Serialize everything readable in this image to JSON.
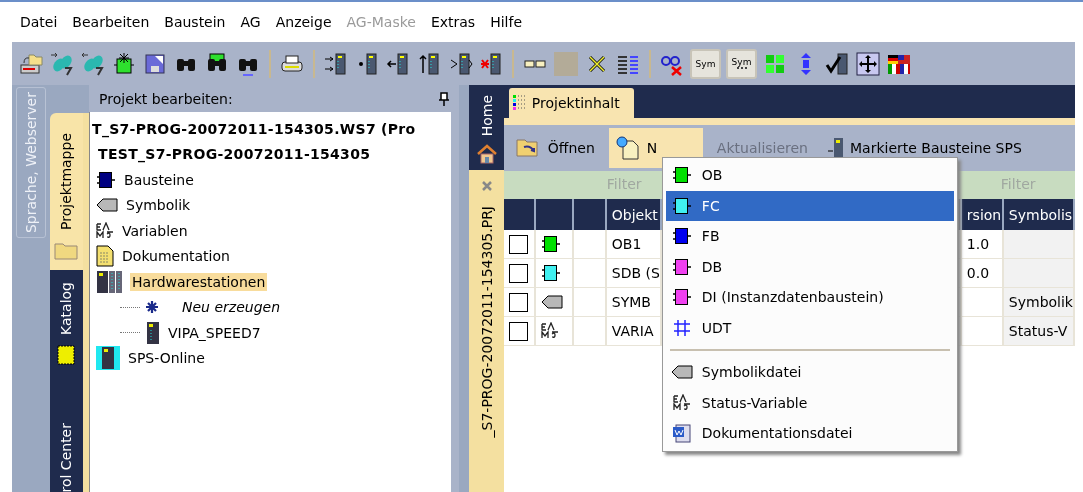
{
  "menu_bar": [
    {
      "label": "Datei",
      "disabled": false
    },
    {
      "label": "Bearbeiten",
      "disabled": false
    },
    {
      "label": "Baustein",
      "disabled": false
    },
    {
      "label": "AG",
      "disabled": false
    },
    {
      "label": "Anzeige",
      "disabled": false
    },
    {
      "label": "AG-Maske",
      "disabled": true
    },
    {
      "label": "Extras",
      "disabled": false
    },
    {
      "label": "Hilfe",
      "disabled": false
    }
  ],
  "toolbar": {
    "sym_buttons": [
      "Sym",
      "Sym"
    ]
  },
  "side_tabs": [
    {
      "label": "Sprache, Webserver",
      "disabled": true
    }
  ],
  "nav_tabs": [
    {
      "label": "Projektmappe",
      "selected": true
    },
    {
      "label": "Katalog",
      "selected": false
    },
    {
      "label": "rol Center",
      "selected": false
    }
  ],
  "tree_panel": {
    "title": "Projekt bearbeiten:",
    "tree": [
      {
        "label": "T_S7-PROG-20072011-154305.WS7 (Pro",
        "kind": "root",
        "selected": false,
        "children": [
          {
            "label": "TEST_S7-PROG-20072011-154305",
            "kind": "root",
            "selected": false,
            "children": [
              {
                "label": "Bausteine",
                "kind": "blocks",
                "selected": false
              },
              {
                "label": "Symbolik",
                "kind": "symbol",
                "selected": false
              },
              {
                "label": "Variablen",
                "kind": "variable",
                "selected": false
              },
              {
                "label": "Dokumentation",
                "kind": "document",
                "selected": false
              },
              {
                "label": "Hardwarestationen",
                "kind": "hardware",
                "selected": true,
                "children": [
                  {
                    "label": "Neu erzeugen",
                    "kind": "new",
                    "selected": false
                  },
                  {
                    "label": "VIPA_SPEED7",
                    "kind": "station",
                    "selected": false
                  }
                ]
              },
              {
                "label": "SPS-Online",
                "kind": "online",
                "selected": false
              }
            ]
          }
        ]
      }
    ]
  },
  "doc_tabs": [
    {
      "label": "Home",
      "kind": "home",
      "selected": false
    },
    {
      "label": "_S7-PROG-20072011-154305.PRJ",
      "kind": "project",
      "selected": true
    }
  ],
  "content": {
    "tabs": [
      {
        "label": "Projektinhalt",
        "selected": true
      }
    ],
    "actions": [
      {
        "label": "Öffnen",
        "kind": "open"
      },
      {
        "label": "N",
        "kind": "new"
      },
      {
        "label": "Aktualisieren",
        "kind": "plain"
      },
      {
        "label": "Markierte Bausteine SPS",
        "kind": "module"
      }
    ],
    "filters": [
      "Filter",
      "Filter"
    ],
    "columns": [
      "Objekt",
      "rsion",
      "Symbolis"
    ],
    "rows": [
      {
        "checked": false,
        "kind": "block",
        "color": "#00e000",
        "cells": [
          "OB1",
          "1.0",
          ""
        ]
      },
      {
        "checked": false,
        "kind": "block",
        "color": "#40f0f0",
        "cells": [
          "SDB (S",
          "0.0",
          ""
        ]
      },
      {
        "checked": false,
        "kind": "symbol",
        "cells": [
          "SYMB",
          "",
          "Symbolik"
        ]
      },
      {
        "checked": false,
        "kind": "variable",
        "cells": [
          "VARIA",
          "",
          "Status-V"
        ]
      }
    ]
  },
  "new_menu": [
    {
      "label": "OB",
      "kind": "block",
      "color": "#00e000",
      "selected": false
    },
    {
      "label": "FC",
      "kind": "block",
      "color": "#40f0f0",
      "selected": true
    },
    {
      "label": "FB",
      "kind": "block",
      "color": "#0000f0",
      "selected": false
    },
    {
      "label": "DB",
      "kind": "block",
      "color": "#f040f0",
      "selected": false
    },
    {
      "label": "DI (Instanzdatenbaustein)",
      "kind": "block",
      "color": "#f040f0",
      "selected": false
    },
    {
      "label": "UDT",
      "kind": "grid",
      "selected": false
    },
    {
      "kind": "separator"
    },
    {
      "label": "Symbolikdatei",
      "kind": "symbol",
      "selected": false
    },
    {
      "label": "Status-Variable",
      "kind": "variable",
      "selected": false
    },
    {
      "label": "Dokumentationsdatei",
      "kind": "word",
      "selected": false
    }
  ]
}
